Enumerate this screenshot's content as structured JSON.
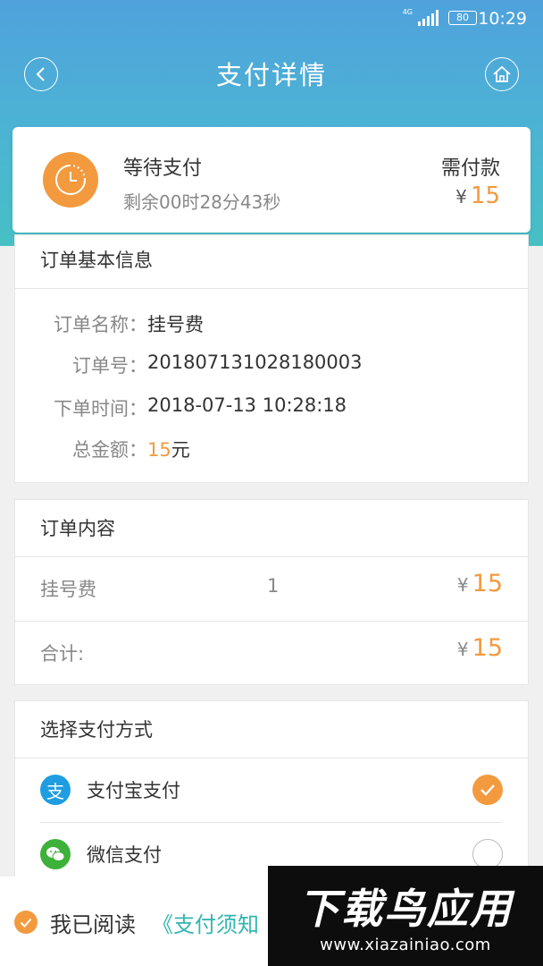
{
  "status_bar": {
    "network": "4G",
    "battery": "80",
    "time": "10:29"
  },
  "nav": {
    "title": "支付详情",
    "back_icon": "back-arrow-icon",
    "home_icon": "home-icon"
  },
  "payment_status": {
    "title": "等待支付",
    "countdown": "剩余00时28分43秒",
    "need_pay_label": "需付款",
    "currency": "¥",
    "amount": "15"
  },
  "order_info": {
    "heading": "订单基本信息",
    "rows": [
      {
        "label": "订单名称：",
        "value": "挂号费"
      },
      {
        "label": "订单号：",
        "value": "201807131028180003"
      },
      {
        "label": "下单时间：",
        "value": "2018-07-13 10:28:18"
      },
      {
        "label": "总金额：",
        "value": "15",
        "unit": "元"
      }
    ]
  },
  "order_content": {
    "heading": "订单内容",
    "item": {
      "name": "挂号费",
      "qty": "1",
      "currency": "¥",
      "amount": "15"
    },
    "total": {
      "label": "合计:",
      "currency": "¥",
      "amount": "15"
    }
  },
  "payment_methods": {
    "heading": "选择支付方式",
    "options": [
      {
        "label": "支付宝支付",
        "icon": "alipay-icon",
        "icon_glyph": "支",
        "selected": true
      },
      {
        "label": "微信支付",
        "icon": "wechat-icon",
        "selected": false
      }
    ]
  },
  "agreement": {
    "text": "我已阅读",
    "link": "《支付须知"
  },
  "watermark": {
    "brand": "下载鸟应用",
    "url": "www.xiazainiao.com"
  },
  "colors": {
    "accent": "#f39a3f",
    "header_top": "#4fa2dc",
    "header_bottom": "#46c0c4",
    "link": "#34b6b0",
    "alipay": "#1e9ee0",
    "wechat": "#3eb13a"
  }
}
